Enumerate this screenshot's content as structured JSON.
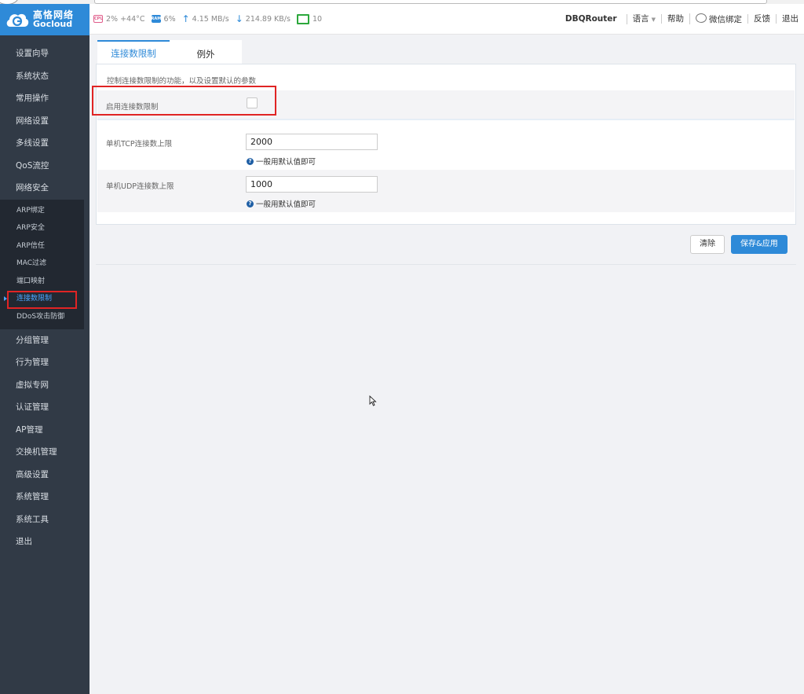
{
  "brand": {
    "name_cn": "高恪网络",
    "name_en": "Gocloud",
    "color": "#2e8ad8"
  },
  "status": {
    "cpu": "2% +44°C",
    "ram": "6%",
    "upload": "4.15 MB/s",
    "download": "214.89 KB/s",
    "clients": "10"
  },
  "topnav": {
    "router": "DBQRouter",
    "language": "语言",
    "help": "帮助",
    "wechat": "微信绑定",
    "feedback": "反馈",
    "logout": "退出"
  },
  "sidebar": {
    "items": [
      {
        "label": "设置向导"
      },
      {
        "label": "系统状态"
      },
      {
        "label": "常用操作"
      },
      {
        "label": "网络设置"
      },
      {
        "label": "多线设置"
      },
      {
        "label": "QoS流控"
      },
      {
        "label": "网络安全"
      }
    ],
    "sub_items": [
      {
        "label": "ARP绑定"
      },
      {
        "label": "ARP安全"
      },
      {
        "label": "ARP信任"
      },
      {
        "label": "MAC过滤"
      },
      {
        "label": "端口映射"
      },
      {
        "label": "连接数限制",
        "active": true
      },
      {
        "label": "DDoS攻击防御"
      }
    ],
    "items_after": [
      {
        "label": "分组管理"
      },
      {
        "label": "行为管理"
      },
      {
        "label": "虚拟专网"
      },
      {
        "label": "认证管理"
      },
      {
        "label": "AP管理"
      },
      {
        "label": "交换机管理"
      },
      {
        "label": "高级设置"
      },
      {
        "label": "系统管理"
      },
      {
        "label": "系统工具"
      },
      {
        "label": "退出"
      }
    ]
  },
  "tabs": [
    {
      "label": "连接数限制",
      "active": true
    },
    {
      "label": "例外",
      "active": false
    }
  ],
  "form": {
    "description": "控制连接数限制的功能，以及设置默认的参数",
    "enable_label": "启用连接数限制",
    "enable_checked": false,
    "tcp_label": "单机TCP连接数上限",
    "tcp_value": "2000",
    "udp_label": "单机UDP连接数上限",
    "udp_value": "1000",
    "hint": "一般用默认值即可"
  },
  "actions": {
    "clear": "清除",
    "save": "保存&应用"
  }
}
